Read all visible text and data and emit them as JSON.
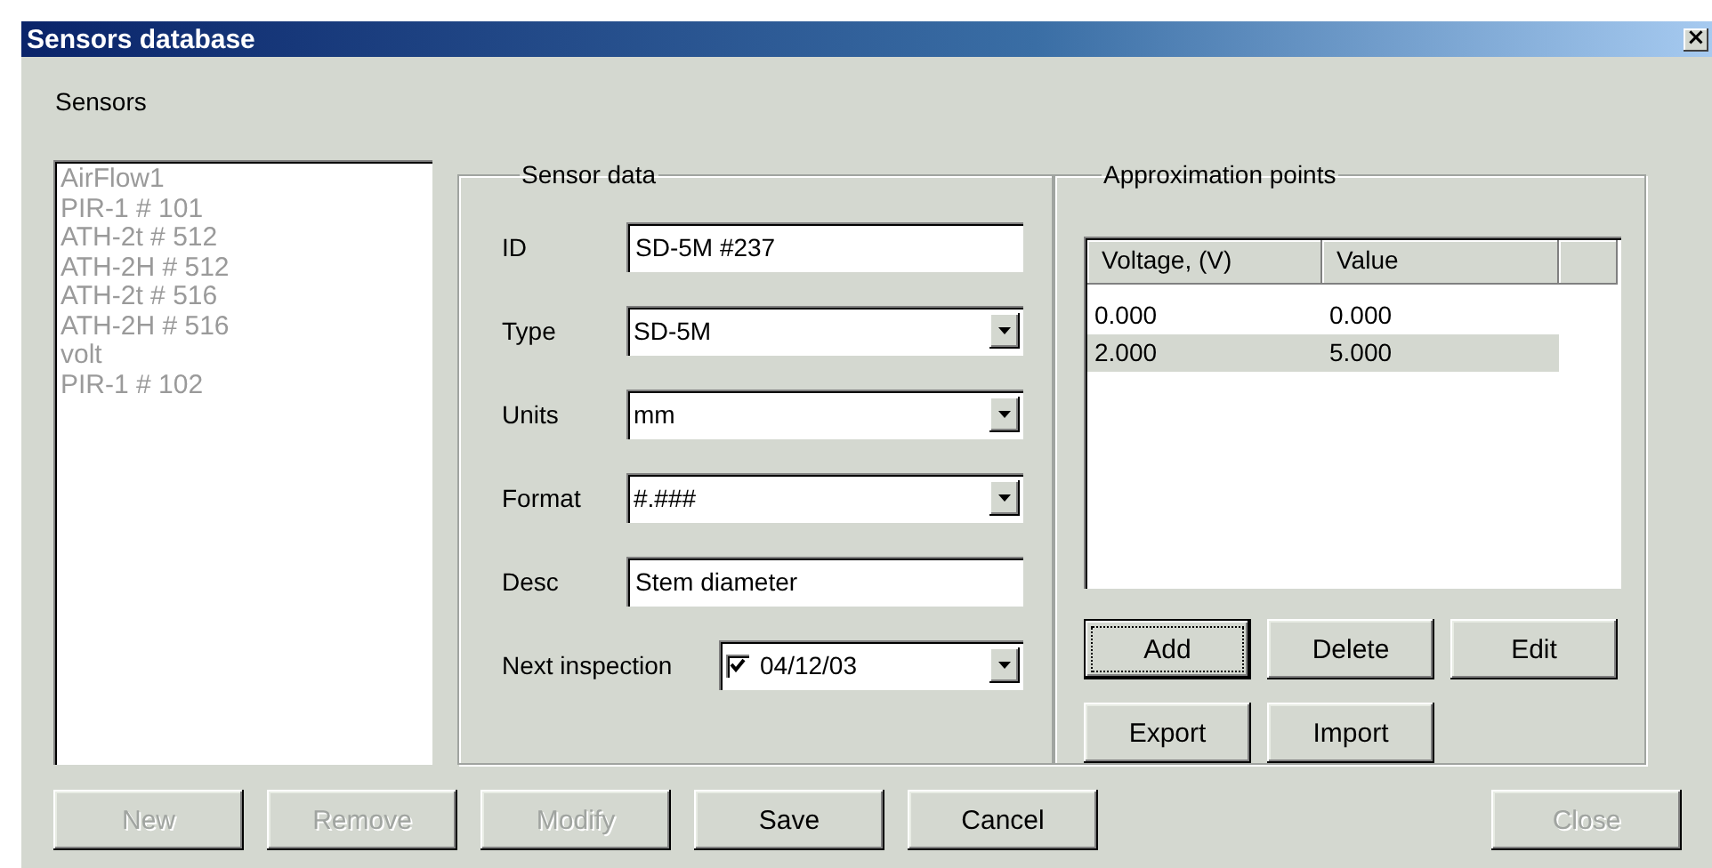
{
  "window": {
    "title": "Sensors database",
    "close": "×"
  },
  "sensors": {
    "label": "Sensors",
    "disabled": true,
    "items": [
      "AirFlow1",
      "PIR-1 # 101",
      "ATH-2t # 512",
      "ATH-2H # 512",
      "ATH-2t # 516",
      "ATH-2H # 516",
      "volt",
      "PIR-1 # 102"
    ]
  },
  "sensor_data": {
    "title": "Sensor data",
    "fields": [
      {
        "label": "ID",
        "kind": "text",
        "value": "SD-5M #237"
      },
      {
        "label": "Type",
        "kind": "dropdown",
        "value": "SD-5M"
      },
      {
        "label": "Units",
        "kind": "dropdown",
        "value": "mm"
      },
      {
        "label": "Format",
        "kind": "dropdown",
        "value": "#.###"
      },
      {
        "label": "Desc",
        "kind": "text",
        "value": "Stem diameter"
      },
      {
        "label": "Next inspection",
        "kind": "date",
        "value": "04/12/03",
        "checked": true
      }
    ]
  },
  "approximation_points": {
    "title": "Approximation points",
    "columns": [
      "Voltage, (V)",
      "Value"
    ],
    "rows": [
      {
        "cells": [
          "0.000",
          "0.000"
        ],
        "selected": false
      },
      {
        "cells": [
          "2.000",
          "5.000"
        ],
        "selected": true
      }
    ],
    "buttons": [
      {
        "label": "Add",
        "disabled": false,
        "focused": true
      },
      {
        "label": "Delete",
        "disabled": false,
        "focused": false
      },
      {
        "label": "Edit",
        "disabled": false,
        "focused": false
      },
      {
        "label": "Export",
        "disabled": false,
        "focused": false
      },
      {
        "label": "Import",
        "disabled": false,
        "focused": false
      }
    ]
  },
  "buttons": [
    {
      "label": "New",
      "disabled": true,
      "focused": false
    },
    {
      "label": "Remove",
      "disabled": true,
      "focused": false
    },
    {
      "label": "Modify",
      "disabled": true,
      "focused": false
    },
    {
      "label": "Save",
      "disabled": false,
      "focused": false
    },
    {
      "label": "Cancel",
      "disabled": false,
      "focused": false
    },
    {
      "label": "Close",
      "disabled": true,
      "focused": false
    }
  ]
}
